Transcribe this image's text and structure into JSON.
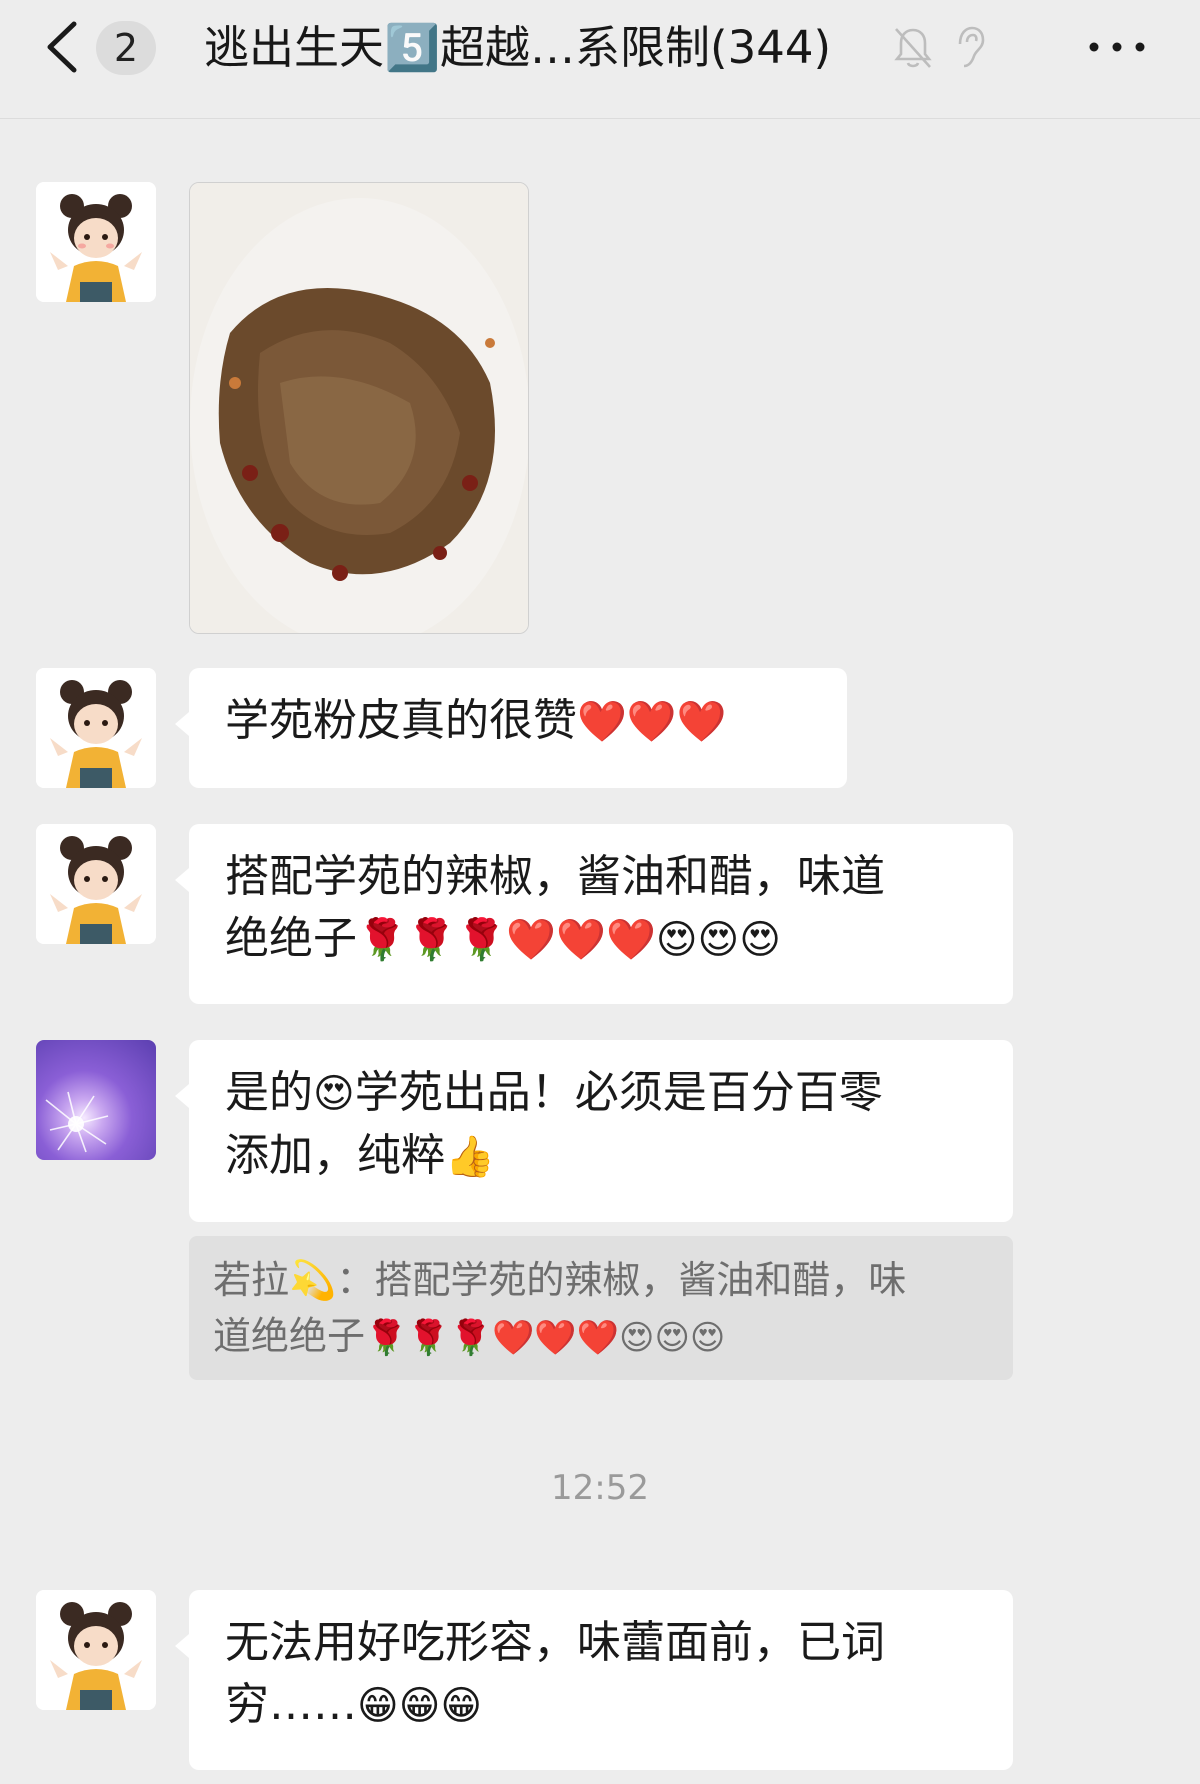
{
  "header": {
    "unread_count": "2",
    "title": "逃出生天5️⃣超越…系限制(344)"
  },
  "messages": {
    "m1": {
      "type": "image",
      "image_desc_icon": "food-photo"
    },
    "m2": {
      "text_main": "学苑粉皮真的很赞",
      "emoji": "❤️❤️❤️"
    },
    "m3": {
      "line1": "搭配学苑的辣椒，酱油和醋，味道",
      "line2_text": "绝绝子",
      "roses": "🌹🌹🌹",
      "hearts": "❤️❤️❤️",
      "faces": "😍😍😍"
    },
    "m4": {
      "line1_a": "是的",
      "line1_emoji": "😍",
      "line1_b": "学苑出品！必须是百分百零",
      "line2": "添加，纯粹",
      "line2_emoji": "👍"
    },
    "quote": {
      "name": "若拉💫：",
      "line1": "搭配学苑的辣椒，酱油和醋，味",
      "line2_text": "道绝绝子",
      "emojis": "🌹🌹🌹❤️❤️❤️😍😍😍"
    },
    "m5": {
      "line1": "无法用好吃形容，味蕾面前，已词",
      "line2": "穷……",
      "emojis": "😁😁😁"
    }
  },
  "timestamp": "12:52",
  "colors": {
    "background": "#ededed",
    "bubble": "#ffffff",
    "quote_bg": "#e0e0e0"
  }
}
